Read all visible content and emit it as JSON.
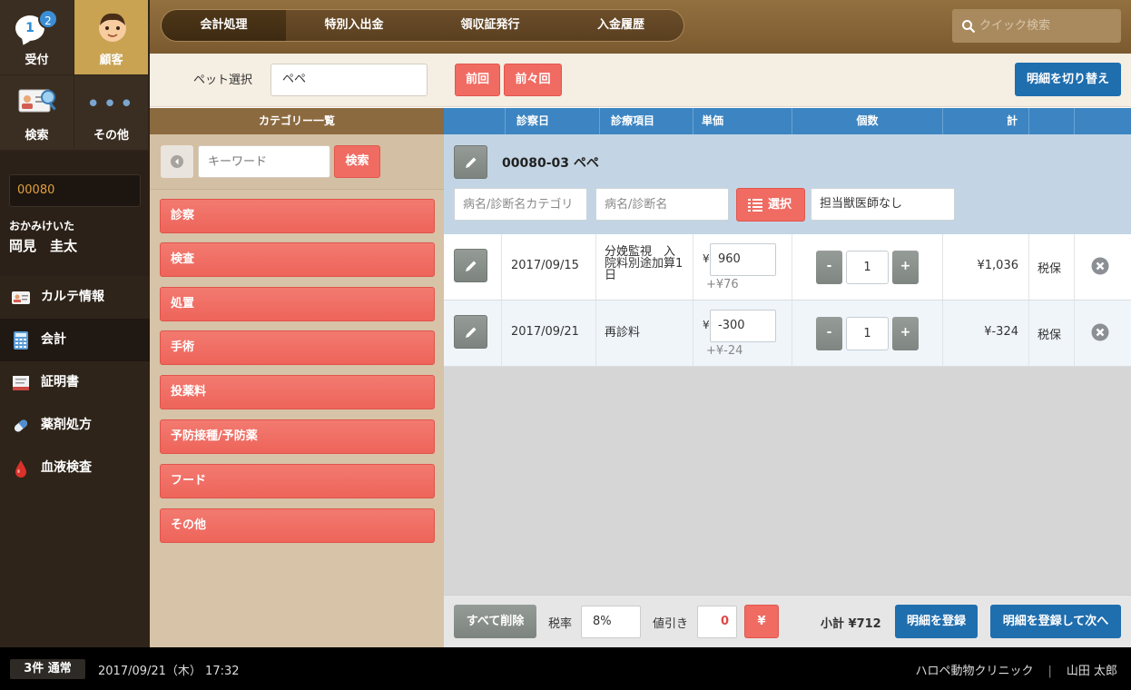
{
  "sidebar": {
    "tiles": [
      {
        "label": "受付",
        "badge": "2",
        "bubble": "1"
      },
      {
        "label": "顧客"
      },
      {
        "label": "検索"
      },
      {
        "label": "その他"
      }
    ],
    "patient": {
      "id": "00080",
      "kana": "おかみけいた",
      "name": "岡見　圭太"
    },
    "menu": [
      {
        "label": "カルテ情報",
        "icon": "id-card-icon"
      },
      {
        "label": "会計",
        "icon": "calculator-icon"
      },
      {
        "label": "証明書",
        "icon": "certificate-icon"
      },
      {
        "label": "薬剤処方",
        "icon": "capsule-icon"
      },
      {
        "label": "血液検査",
        "icon": "blood-drop-icon"
      }
    ]
  },
  "header": {
    "tabs": [
      "会計処理",
      "特別入出金",
      "領収証発行",
      "入金履歴"
    ],
    "search_placeholder": "クイック検索"
  },
  "petbar": {
    "label": "ペット選択",
    "value": "ペペ",
    "prev": "前回",
    "prev2": "前々回",
    "switch": "明細を切り替え"
  },
  "categories": {
    "title": "カテゴリー一覧",
    "keyword_placeholder": "キーワード",
    "search": "検索",
    "items": [
      "診察",
      "検査",
      "処置",
      "手術",
      "投薬料",
      "予防接種/予防薬",
      "フード",
      "その他"
    ]
  },
  "table": {
    "headers": [
      "診察日",
      "診療項目",
      "単価",
      "個数",
      "計"
    ],
    "group": {
      "title": "00080-03 ペペ",
      "diag_category_placeholder": "病名/診断名カテゴリ",
      "diag_placeholder": "病名/診断名",
      "select": "選択",
      "vet": "担当獣医師なし"
    },
    "rows": [
      {
        "date": "2017/09/15",
        "item": "分娩監視　入院料別途加算1日",
        "yen": "¥",
        "price": "960",
        "tax_note": "+¥76",
        "qty": "1",
        "total": "¥1,036",
        "tax_type": "税保",
        "minus": "-",
        "plus": "+"
      },
      {
        "date": "2017/09/21",
        "item": "再診料",
        "yen": "¥",
        "price": "-300",
        "tax_note": "+¥-24",
        "qty": "1",
        "total": "¥-324",
        "tax_type": "税保",
        "minus": "-",
        "plus": "+"
      }
    ]
  },
  "footer": {
    "clear": "すべて削除",
    "tax_label": "税率",
    "tax_value": "8%",
    "discount_label": "値引き",
    "discount_value": "0",
    "yen_button": "¥",
    "subtotal": "小計 ¥712",
    "register": "明細を登録",
    "register_next": "明細を登録して次へ"
  },
  "status": {
    "badge": "3件 通常",
    "datetime": "2017/09/21（木） 17:32",
    "clinic": "ハロペ動物クリニック",
    "user": "山田 太郎"
  },
  "colors": {
    "accent_red": "#f06b62",
    "accent_blue": "#1f6eae",
    "header_brown": "#7b5a30",
    "table_header_blue": "#3c85c2"
  }
}
